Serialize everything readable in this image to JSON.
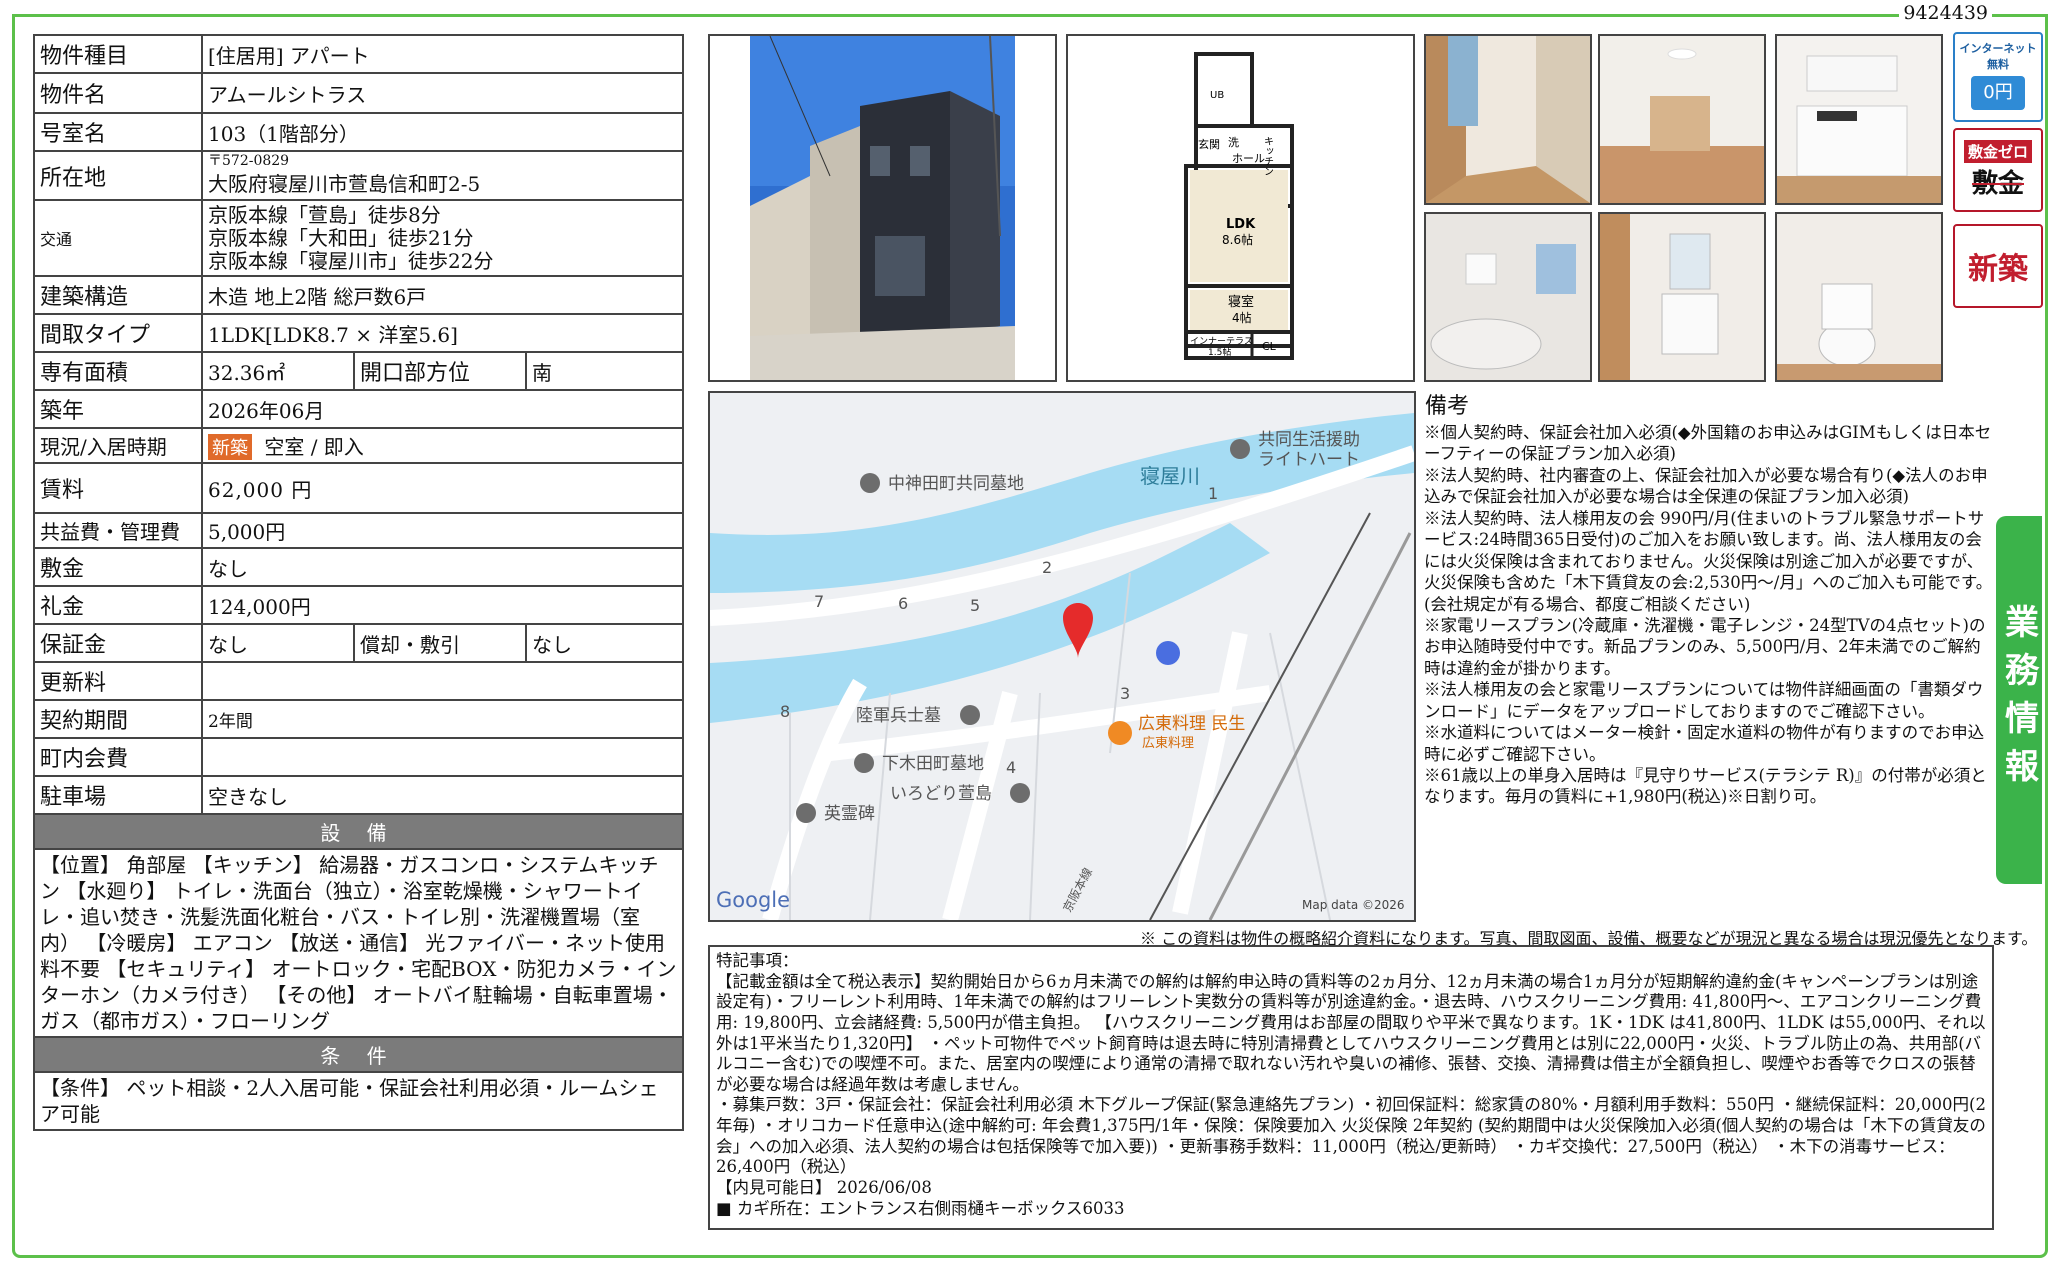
{
  "doc_id": "9424439",
  "property": {
    "type_label": "物件種目",
    "type_value": "[住居用] アパート",
    "name_label": "物件名",
    "name_value": "アムールシトラス",
    "room_label": "号室名",
    "room_value": "103（1階部分）",
    "address_label": "所在地",
    "address_zip": "〒572-0829",
    "address_value": "大阪府寝屋川市萱島信和町2-5",
    "transit_label": "交通",
    "transit": [
      "京阪本線「萱島」徒歩8分",
      "京阪本線「大和田」徒歩21分",
      "京阪本線「寝屋川市」徒歩22分"
    ],
    "structure_label": "建築構造",
    "structure_value": "木造 地上2階 総戸数6戸",
    "layout_label": "間取タイプ",
    "layout_value": "1LDK[LDK8.7 × 洋室5.6]",
    "area_label": "専有面積",
    "area_value": "32.36㎡",
    "opening_label": "開口部方位",
    "opening_value": "南",
    "year_label": "築年",
    "year_value": "2026年06月",
    "status_label": "現況/入居時期",
    "status_badge": "新築",
    "status_value": "空室 / 即入",
    "rent_label": "賃料",
    "rent_value": "62,000 円",
    "fee_label": "共益費・管理費",
    "fee_value": "5,000円",
    "deposit_label": "敷金",
    "deposit_value": "なし",
    "key_money_label": "礼金",
    "key_money_value": "124,000円",
    "guarantee_label": "保証金",
    "guarantee_value": "なし",
    "amortization_label": "償却・敷引",
    "amortization_value": "なし",
    "renewal_label": "更新料",
    "renewal_value": "",
    "contract_label": "契約期間",
    "contract_value": "2年間",
    "community_label": "町内会費",
    "community_value": "",
    "parking_label": "駐車場",
    "parking_value": "空きなし"
  },
  "equipment": {
    "heading": "設 備",
    "text": "【位置】 角部屋 【キッチン】 給湯器・ガスコンロ・システムキッチン 【水廻り】 トイレ・洗面台（独立）・浴室乾燥機・シャワートイレ・追い焚き・洗髪洗面化粧台・バス・トイレ別・洗濯機置場（室内） 【冷暖房】 エアコン 【放送・通信】 光ファイバー・ネット使用料不要 【セキュリティ】 オートロック・宅配BOX・防犯カメラ・インターホン（カメラ付き） 【その他】 オートバイ駐輪場・自転車置場・ガス（都市ガス）・フローリング"
  },
  "conditions": {
    "heading": "条 件",
    "text": "【条件】 ペット相談・2人入居可能・保証会社利用必須・ルームシェア可能"
  },
  "floorplan": {
    "ub": "UB",
    "wash": "洗",
    "entrance": "玄関",
    "shoebox": "ホール",
    "kitchen": "キッチン",
    "ldk": "LDK",
    "ldk_size": "8.6帖",
    "bedroom": "寝室",
    "bedroom_size": "4帖",
    "terrace": "インナーテラス",
    "terrace_size": "1.5帖",
    "cl": "CL"
  },
  "map": {
    "river": "寝屋川",
    "places": [
      "共同生活援助",
      "ライトハート",
      "中神田町共同墓地",
      "陸軍兵士墓",
      "下木田町墓地",
      "いろどり萱島",
      "英霊碑",
      "広東料理 民生",
      "広東料理"
    ],
    "block_numbers": [
      "1",
      "2",
      "3",
      "4",
      "5",
      "6",
      "7",
      "8"
    ],
    "rail": "京阪本線",
    "google": "Google",
    "copyright": "Map data ©2026"
  },
  "badges": {
    "internet": "インターネット無料",
    "internet_price": "0円",
    "deposit_zero_top": "敷金ゼロ",
    "deposit_zero_main": "敷金",
    "new_build": "新築"
  },
  "notes": {
    "title": "備考",
    "lines": [
      "※個人契約時、保証会社加入必須(◆外国籍のお申込みはGIMもしくは日本セーフティーの保証プラン加入必須)",
      "※法人契約時、社内審査の上、保証会社加入が必要な場合有り(◆法人のお申込みで保証会社加入が必要な場合は全保連の保証プラン加入必須)",
      "※法人契約時、法人様用友の会 990円/月(住まいのトラブル緊急サポートサービス:24時間365日受付)のご加入をお願い致します。尚、法人様用友の会には火災保険は含まれておりません。火災保険は別途ご加入が必要ですが、火災保険も含めた「木下賃貸友の会:2,530円～/月」へのご加入も可能です。(会社規定が有る場合、都度ご相談ください)",
      "※家電リースプラン(冷蔵庫・洗濯機・電子レンジ・24型TVの4点セット)のお申込随時受付中です。新品プランのみ、5,500円/月、2年未満でのご解約時は違約金が掛かります。",
      "※法人様用友の会と家電リースプランについては物件詳細画面の「書類ダウンロード」にデータをアップロードしておりますのでご確認下さい。",
      "※水道料についてはメーター検針・固定水道料の物件が有りますのでお申込時に必ずご確認下さい。",
      "※61歳以上の単身入居時は『見守りサービス(テラシテ R)』の付帯が必須となります。毎月の賃料に+1,980円(税込)※日割り可。"
    ]
  },
  "side_tab": "業務情報",
  "disclaimer": "※ この資料は物件の概略紹介資料になります。写真、間取図面、設備、概要などが現況と異なる場合は現況優先となります。",
  "special": {
    "title": "特記事項：",
    "lines": [
      "【記載金額は全て税込表示】契約開始日から6ヵ月未満での解約は解約申込時の賃料等の2ヵ月分、12ヵ月未満の場合1ヵ月分が短期解約違約金(キャンペーンプランは別途設定有)・フリーレント利用時、1年未満での解約はフリーレント実数分の賃料等が別途違約金。・退去時、ハウスクリーニング費用: 41,800円～、エアコンクリーニング費用: 19,800円、立会諸経費: 5,500円が借主負担。 【ハウスクリーニング費用はお部屋の間取りや平米で異なります。1K・1DK は41,800円、1LDK は55,000円、それ以外は1平米当たり1,320円】 ・ペット可物件でペット飼育時は退去時に特別清掃費としてハウスクリーニング費用とは別に22,000円・火災、トラブル防止の為、共用部(バルコニー含む)での喫煙不可。また、居室内の喫煙により通常の清掃で取れない汚れや臭いの補修、張替、交換、清掃費は借主が全額負担し、喫煙やお香等でクロスの張替が必要な場合は経過年数は考慮しません。",
      "・募集戸数：3戸・保証会社：保証会社利用必須 木下グループ保証(緊急連絡先プラン) ・初回保証料：総家賃の80%・月額利用手数料：550円 ・継続保証料：20,000円(2年毎) ・オリコカード任意申込(途中解約可: 年会費1,375円/1年・保険：保険要加入 火災保険 2年契約 (契約期間中は火災保険加入必須(個人契約の場合は「木下の賃貸友の会」への加入必須、法人契約の場合は包括保険等で加入要)) ・更新事務手数料：11,000円（税込/更新時） ・カギ交換代：27,500円（税込） ・木下の消毒サービス：26,400円（税込）",
      "【内見可能日】 2026/06/08",
      "■ カギ所在：エントランス右側雨樋キーボックス6033"
    ]
  }
}
